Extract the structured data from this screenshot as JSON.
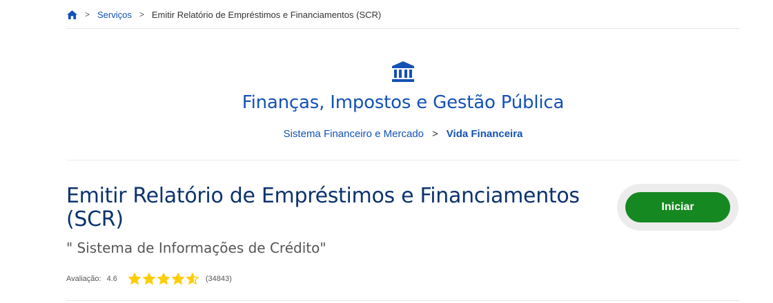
{
  "breadcrumb": {
    "home_icon": "home-icon",
    "items": [
      "Serviços",
      "Emitir Relatório de Empréstimos e Financiamentos (SCR)"
    ],
    "separator": ">"
  },
  "category": {
    "icon": "bank-building-icon",
    "title": "Finanças, Impostos e Gestão Pública",
    "subcategory": "Sistema Financeiro e Mercado",
    "separator": ">",
    "active_subcategory": "Vida Financeira"
  },
  "service": {
    "title": "Emitir Relatório de Empréstimos e Financiamentos (SCR)",
    "subtitle": "\" Sistema de Informações de Crédito\"",
    "start_button": "Iniciar"
  },
  "rating": {
    "label": "Avaliação:",
    "value": "4.6",
    "stars_filled": 4.6,
    "stars_total": 5,
    "count": "(34843)"
  },
  "colors": {
    "primary_blue": "#1351b4",
    "title_navy": "#0c326f",
    "button_green": "#168821",
    "star_yellow": "#ffcd07"
  }
}
